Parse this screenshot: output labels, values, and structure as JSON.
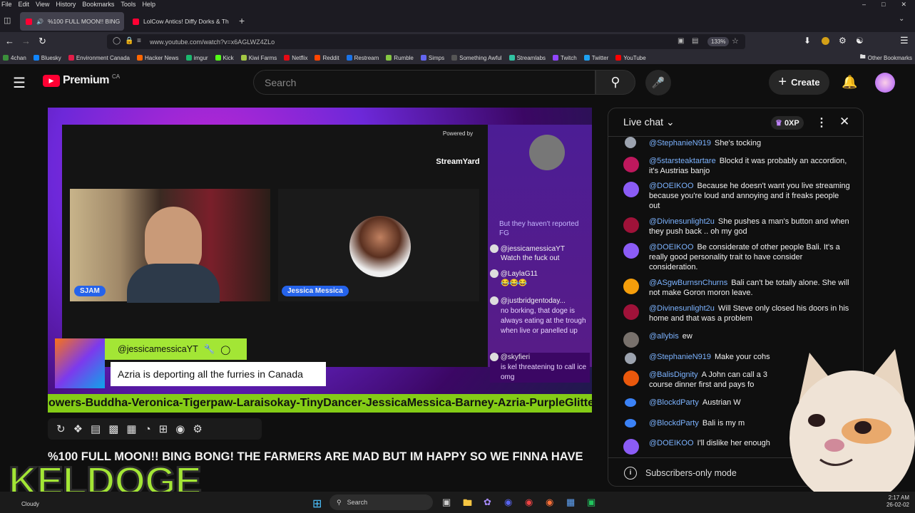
{
  "menubar": {
    "items": [
      "File",
      "Edit",
      "View",
      "History",
      "Bookmarks",
      "Tools",
      "Help"
    ]
  },
  "tabs": [
    {
      "label": "%100 FULL MOON!! BING",
      "active": true
    },
    {
      "label": "LolCow Antics! Diffy Dorks & Th",
      "active": false
    }
  ],
  "nav": {
    "url": "www.youtube.com/watch?v=x6AGLWZ4ZLo",
    "zoom": "133%"
  },
  "bookmarks": [
    {
      "label": "4chan",
      "color": "#3b8f3b"
    },
    {
      "label": "Bluesky",
      "color": "#1185fe"
    },
    {
      "label": "Environment Canada",
      "color": "#e11d48"
    },
    {
      "label": "Hacker News",
      "color": "#ff6600"
    },
    {
      "label": "imgur",
      "color": "#1bb76e"
    },
    {
      "label": "Kick",
      "color": "#53fc18"
    },
    {
      "label": "Kiwi Farms",
      "color": "#a3c644"
    },
    {
      "label": "Netflix",
      "color": "#e50914"
    },
    {
      "label": "Reddit",
      "color": "#ff4500"
    },
    {
      "label": "Restream",
      "color": "#1a73e8"
    },
    {
      "label": "Rumble",
      "color": "#85c742"
    },
    {
      "label": "Simps",
      "color": "#6366f1"
    },
    {
      "label": "Something Awful",
      "color": "#222222"
    },
    {
      "label": "Streamlabs",
      "color": "#31c3a2"
    },
    {
      "label": "Twitch",
      "color": "#9146ff"
    },
    {
      "label": "Twitter",
      "color": "#1da1f2"
    },
    {
      "label": "YouTube",
      "color": "#ff0000"
    }
  ],
  "other_bookmarks": "Other Bookmarks",
  "yt": {
    "logo": "Premium",
    "region": "CA",
    "search_placeholder": "Search",
    "create_label": "Create"
  },
  "video": {
    "powered_by": "Powered by",
    "streamyard": "StreamYard",
    "cam1_label": "SJAM",
    "cam2_label": "Jessica Messica",
    "overlay_user": "@jessicamessicaYT",
    "overlay_text": "Azria is deporting all the furries in Canada",
    "ticker": "owers-Buddha-Veronica-Tigerpaw-Laraisokay-TinyDancer-JessicaMessica-Barney-Azria-PurpleGlitter-Sag",
    "side_chat": [
      {
        "user": "",
        "text": "But they haven't reported FG"
      },
      {
        "user": "@jessicamessicaYT",
        "text": "Watch the fuck out"
      },
      {
        "user": "@LaylaG11",
        "text": "😂😂😂"
      },
      {
        "user": "@justbridgentoday...",
        "text": "no borking, that doge is always eating at the trough when live or panelled up"
      },
      {
        "user": "@skyfieri",
        "text": "is kel threatening to call ice omg"
      }
    ],
    "title": "%100 FULL MOON!! BING BONG! THE FARMERS ARE MAD BUT IM HAPPY SO WE FINNA HAVE"
  },
  "chat": {
    "header": "Live chat",
    "xp": "0XP",
    "messages": [
      {
        "author": "@StephanieN919",
        "text": "She's tocking",
        "color": "#9ca3af"
      },
      {
        "author": "@5starsteaktartare",
        "text": "Blockd it was probably an accordion, it's Austrias banjo",
        "color": "#be185d"
      },
      {
        "author": "@DOEIKOO",
        "text": "Because he doesn't want you live streaming because you're loud and annoying and it freaks people out",
        "color": "#8b5cf6"
      },
      {
        "author": "@Divinesunlight2u",
        "text": "She pushes a man's button and when they push back .. oh my god",
        "color": "#9f1239"
      },
      {
        "author": "@DOEIKOO",
        "text": "Be considerate of other people Bali. It's a really good personality trait to have consider consideration.",
        "color": "#8b5cf6"
      },
      {
        "author": "@ASgwBurnsnChurns",
        "text": "Bali can't be totally alone. She will not make Goron moron leave.",
        "color": "#f59e0b"
      },
      {
        "author": "@Divinesunlight2u",
        "text": "Will Steve only closed his doors in his home and that was a problem",
        "color": "#9f1239"
      },
      {
        "author": "@allybis",
        "text": "ew",
        "color": "#78716c"
      },
      {
        "author": "@StephanieN919",
        "text": "Make your cohs",
        "color": "#9ca3af"
      },
      {
        "author": "@BalisDignity",
        "text": "A John can call a 3 course dinner first and pays fo",
        "color": "#ea580c"
      },
      {
        "author": "@BlockdParty",
        "text": "Austrian W",
        "color": "#3b82f6"
      },
      {
        "author": "@BlockdParty",
        "text": "Bali is my m",
        "color": "#3b82f6"
      },
      {
        "author": "@DOEIKOO",
        "text": "I'll dislike her enough",
        "color": "#8b5cf6"
      }
    ],
    "footer": "Subscribers-only mode"
  },
  "taskbar": {
    "weather": "Cloudy",
    "search": "Search",
    "time": "2:17 AM",
    "date": "26-02-02"
  },
  "watermark": "KELDOGE"
}
